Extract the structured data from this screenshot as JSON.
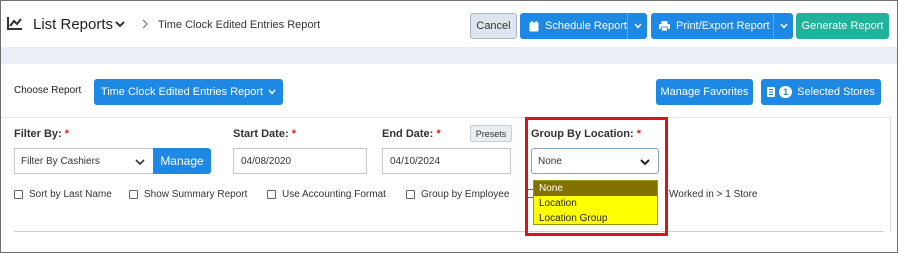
{
  "header": {
    "title": "List Reports",
    "breadcrumb": "Time Clock Edited Entries Report",
    "cancel_label": "Cancel",
    "schedule_label": "Schedule Report",
    "print_label": "Print/Export Report",
    "generate_label": "Generate Report"
  },
  "report": {
    "choose_label": "Choose Report",
    "selected_report": "Time Clock Edited Entries Report",
    "manage_favorites_label": "Manage Favorites",
    "selected_stores_count": "1",
    "selected_stores_label": "Selected Stores"
  },
  "filters": {
    "filter_by_label": "Filter By:",
    "filter_by_value": "Filter By Cashiers",
    "manage_label": "Manage",
    "start_date_label": "Start Date:",
    "start_date_value": "04/08/2020",
    "end_date_label": "End Date:",
    "end_date_value": "04/10/2024",
    "presets_label": "Presets",
    "group_by_label": "Group By Location:",
    "group_by_value": "None",
    "required_mark": "*"
  },
  "dropdown": {
    "options": [
      "None",
      "Location",
      "Location Group"
    ],
    "selected": "None"
  },
  "checkboxes": {
    "sort_last_name": "Sort by Last Name",
    "summary_report": "Show Summary Report",
    "accounting_format": "Use Accounting Format",
    "group_employee": "Group by Employee",
    "worked_multi": "Worked in > 1 Store"
  },
  "colors": {
    "primary": "#1e88e5",
    "generate": "#20b39b",
    "highlight": "#ffff00",
    "selected_option": "#817200",
    "annotation": "#d4161a"
  }
}
